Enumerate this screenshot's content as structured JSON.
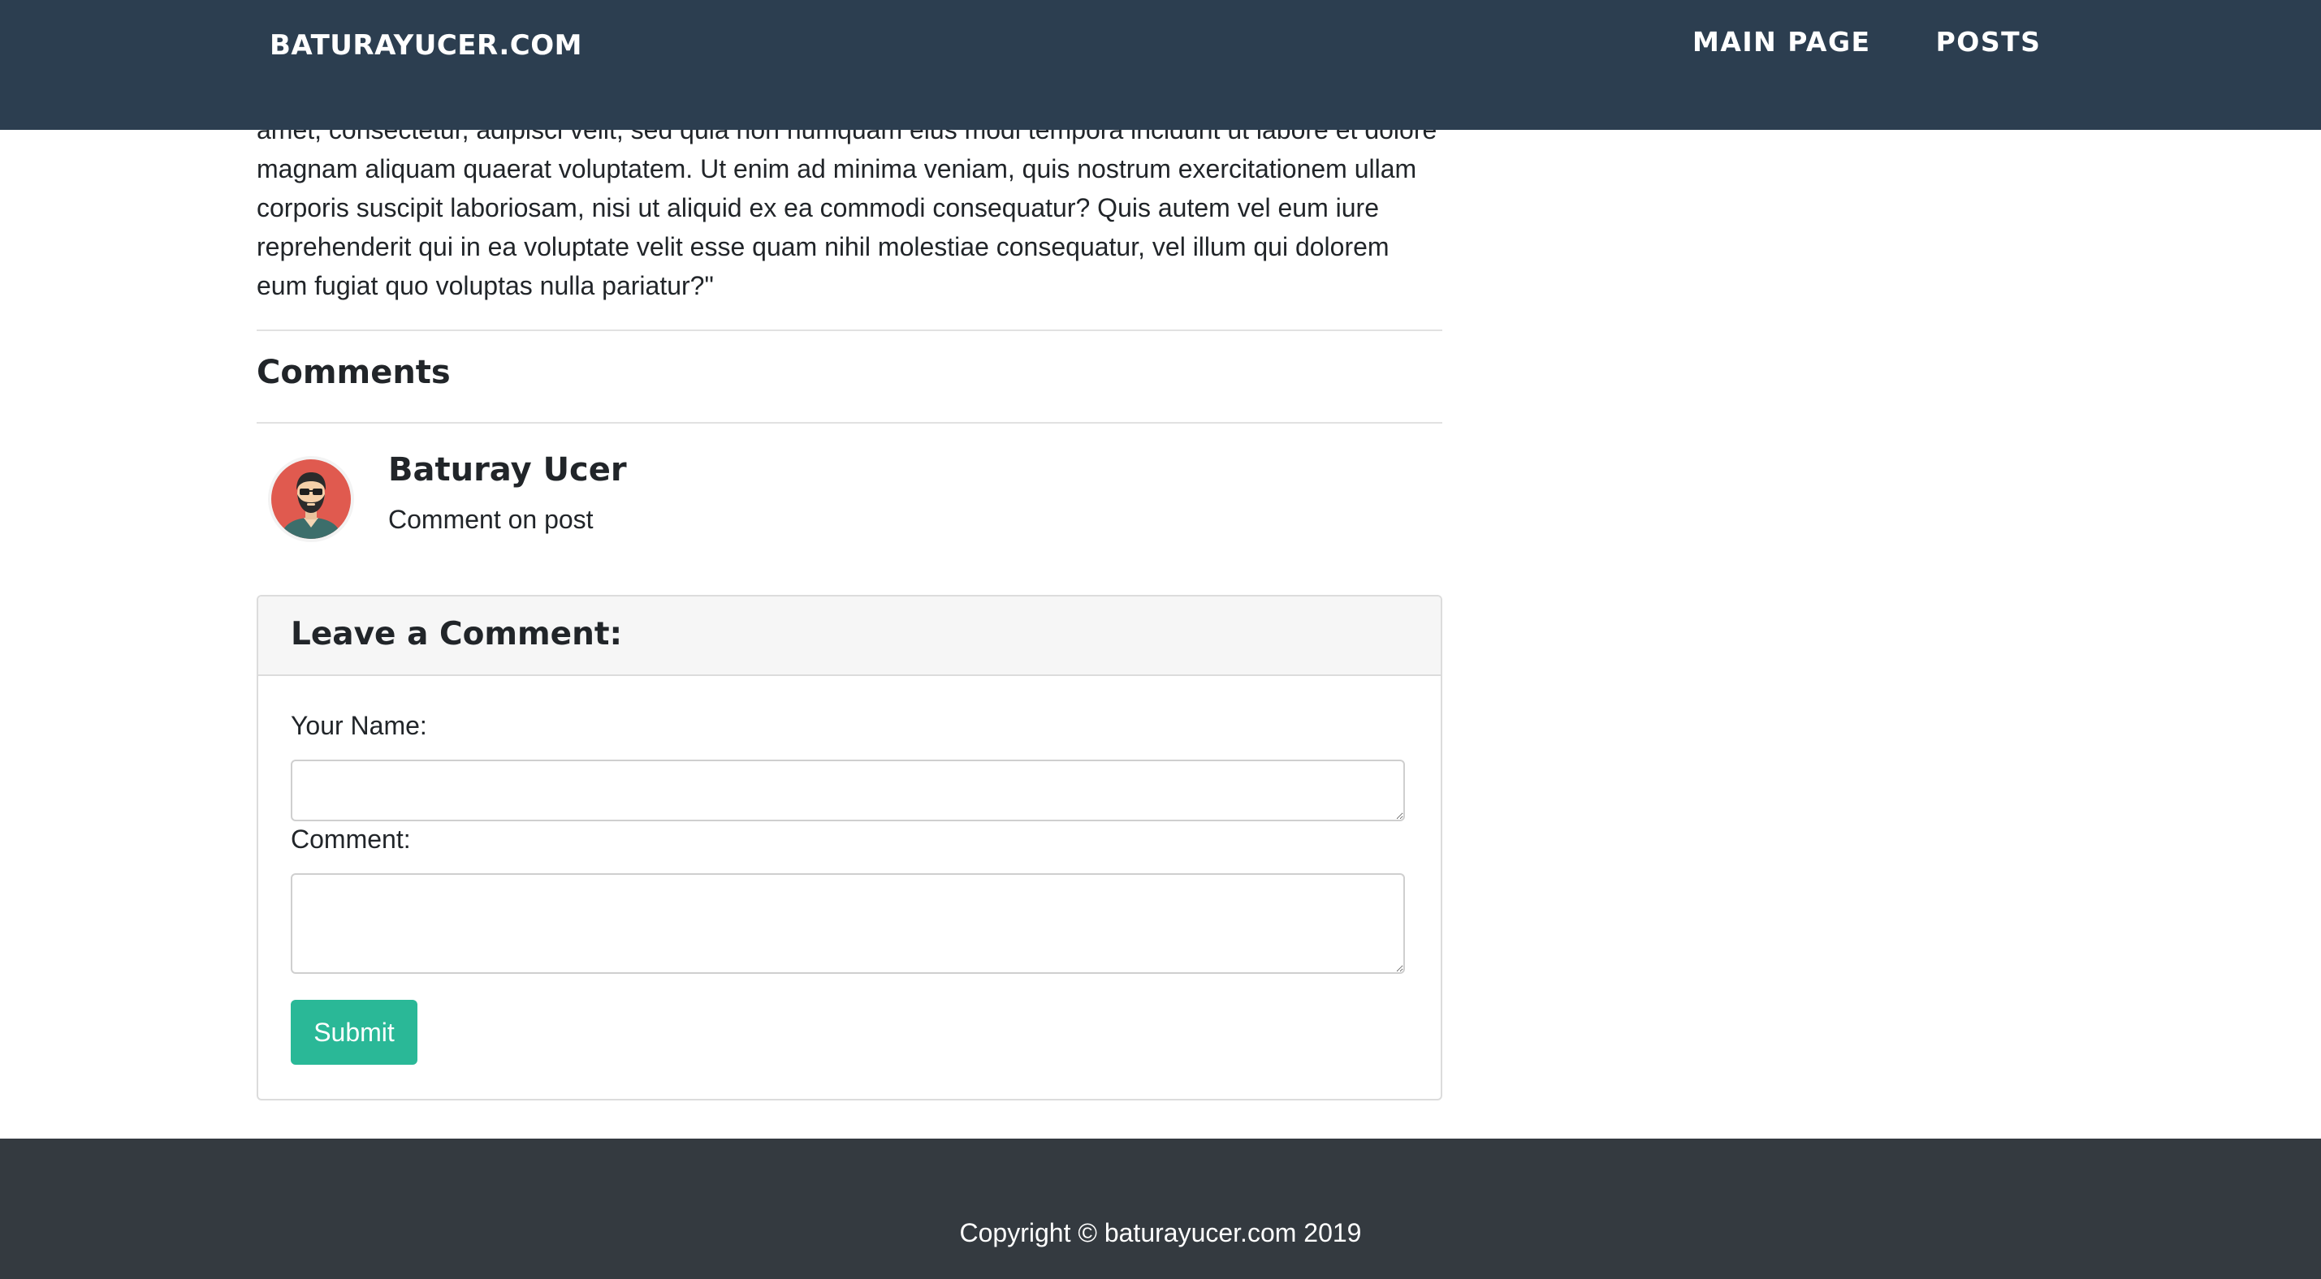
{
  "navbar": {
    "brand": "BATURAYUCER.COM",
    "links": [
      "MAIN PAGE",
      "POSTS"
    ]
  },
  "post": {
    "text": "amet, consectetur, adipisci velit, sed quia non numquam eius modi tempora incidunt ut labore et dolore magnam aliquam quaerat voluptatem. Ut enim ad minima veniam, quis nostrum exercitationem ullam corporis suscipit laboriosam, nisi ut aliquid ex ea commodi consequatur? Quis autem vel eum iure reprehenderit qui in ea voluptate velit esse quam nihil molestiae consequatur, vel illum qui dolorem eum fugiat quo voluptas nulla pariatur?\""
  },
  "comments": {
    "heading": "Comments",
    "items": [
      {
        "author": "Baturay Ucer",
        "body": "Comment on post",
        "avatar_icon": "bearded-man-avatar-icon"
      }
    ]
  },
  "comment_form": {
    "title": "Leave a Comment:",
    "name_label": "Your Name:",
    "name_value": "",
    "comment_label": "Comment:",
    "comment_value": "",
    "submit_label": "Submit"
  },
  "footer": {
    "copyright": "Copyright © baturayucer.com 2019"
  },
  "colors": {
    "navbar_bg": "#2c3e50",
    "footer_bg": "#343a40",
    "accent": "#2ab897",
    "avatar_bg": "#e05a4f"
  }
}
